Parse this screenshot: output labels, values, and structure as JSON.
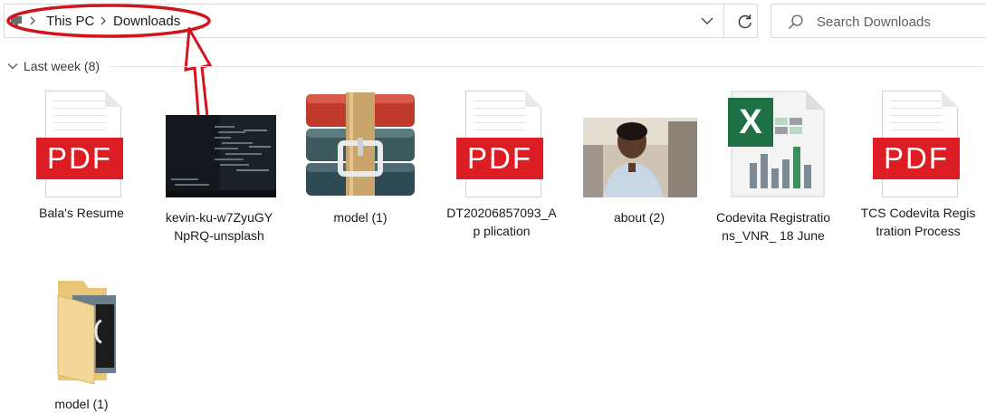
{
  "address_bar": {
    "breadcrumbs": [
      "This PC",
      "Downloads"
    ]
  },
  "search": {
    "placeholder": "Search Downloads"
  },
  "group": {
    "label": "Last week (8)"
  },
  "pdf_label": "PDF",
  "files": [
    {
      "name": "Bala's Resume",
      "type": "pdf"
    },
    {
      "name": "kevin-ku-w7ZyuGY NpRQ-unsplash",
      "type": "image"
    },
    {
      "name": "model (1)",
      "type": "archive"
    },
    {
      "name": "DT20206857093_Ap plication",
      "type": "pdf"
    },
    {
      "name": "about (2)",
      "type": "image"
    },
    {
      "name": "Codevita Registrations_VNR_ 18 June",
      "type": "excel"
    },
    {
      "name": "TCS Codevita Registration Process",
      "type": "pdf"
    },
    {
      "name": "model (1)",
      "type": "folder"
    }
  ],
  "colors": {
    "annotation": "#d2141c",
    "pdf_red": "#dc1e24",
    "excel_green": "#1e7145"
  }
}
